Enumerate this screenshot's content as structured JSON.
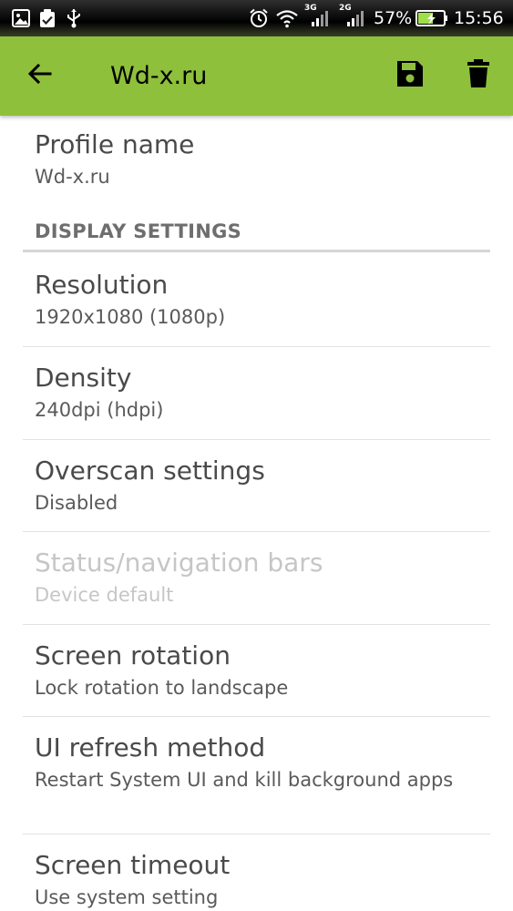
{
  "status_bar": {
    "network_3g": "3G",
    "network_2g": "2G",
    "battery": "57%",
    "time": "15:56"
  },
  "toolbar": {
    "title": "Wd-x.ru"
  },
  "profile": {
    "title": "Profile name",
    "value": "Wd-x.ru"
  },
  "display_settings": {
    "header": "DISPLAY SETTINGS",
    "items": [
      {
        "title": "Resolution",
        "summary": "1920x1080 (1080p)",
        "enabled": true
      },
      {
        "title": "Density",
        "summary": "240dpi (hdpi)",
        "enabled": true
      },
      {
        "title": "Overscan settings",
        "summary": "Disabled",
        "enabled": true
      },
      {
        "title": "Status/navigation bars",
        "summary": "Device default",
        "enabled": false
      },
      {
        "title": "Screen rotation",
        "summary": "Lock rotation to landscape",
        "enabled": true
      },
      {
        "title": "UI refresh method",
        "summary": "Restart System UI and kill background apps",
        "enabled": true
      },
      {
        "title": "Screen timeout",
        "summary": "Use system setting",
        "enabled": true
      }
    ]
  },
  "colors": {
    "toolbar": "#8ec03b",
    "status_bar": "#000000",
    "disabled_text": "#c6c6c6"
  }
}
